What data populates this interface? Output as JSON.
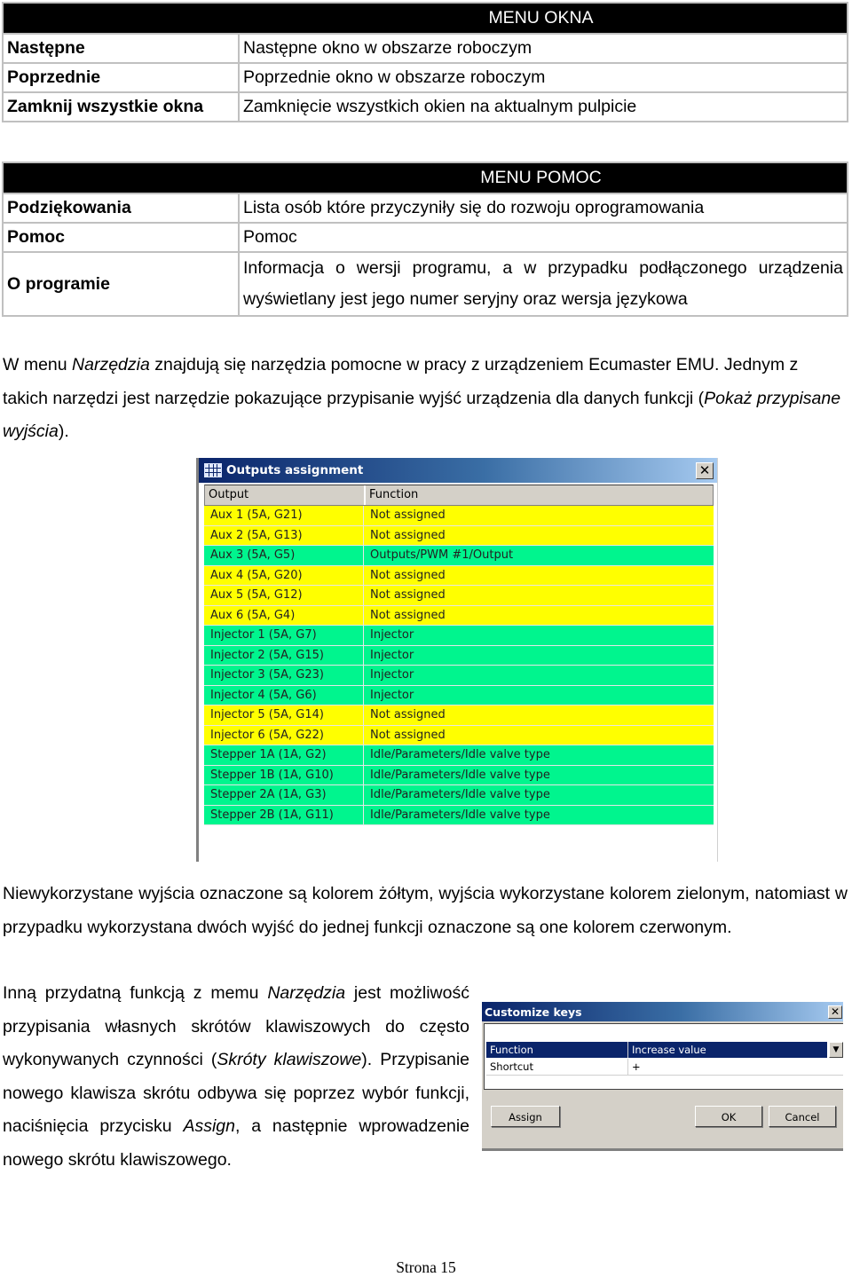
{
  "menu_okna": {
    "title": "MENU OKNA",
    "rows": [
      {
        "key": "Następne",
        "desc": "Następne okno w obszarze roboczym"
      },
      {
        "key": "Poprzednie",
        "desc": "Poprzednie okno w obszarze roboczym"
      },
      {
        "key": "Zamknij wszystkie okna",
        "desc": "Zamknięcie wszystkich okien na aktualnym pulpicie"
      }
    ]
  },
  "menu_pomoc": {
    "title": "MENU POMOC",
    "rows": [
      {
        "key": "Podziękowania",
        "desc": "Lista osób które przyczyniły się do rozwoju oprogramowania"
      },
      {
        "key": "Pomoc",
        "desc": "Pomoc"
      },
      {
        "key": "O programie",
        "desc": "Informacja o wersji programu, a w przypadku podłączonego urządzenia wyświetlany jest jego numer seryjny oraz wersja językowa"
      }
    ]
  },
  "para1": {
    "t1": "W menu ",
    "i1": "Narzędzia",
    "t2": " znajdują się narzędzia pomocne w pracy z urządzeniem Ecumaster EMU. Jednym z takich narzędzi jest narzędzie pokazujące przypisanie wyjść urządzenia dla danych funkcji (",
    "i2": "Pokaż przypisane wyjścia",
    "t3": ")."
  },
  "outputs_window": {
    "title": "Outputs assignment",
    "close": "✕",
    "columns": [
      "Output",
      "Function"
    ],
    "colors": {
      "unused": "#ffff00",
      "used": "#00f58e",
      "double": "#ff0000"
    },
    "rows": [
      {
        "output": "Aux 1 (5A, G21)",
        "function": "Not assigned",
        "status": "unused"
      },
      {
        "output": "Aux 2 (5A, G13)",
        "function": "Not assigned",
        "status": "unused"
      },
      {
        "output": "Aux 3 (5A, G5)",
        "function": "Outputs/PWM #1/Output",
        "status": "used"
      },
      {
        "output": "Aux 4 (5A, G20)",
        "function": "Not assigned",
        "status": "unused"
      },
      {
        "output": "Aux 5 (5A, G12)",
        "function": "Not assigned",
        "status": "unused"
      },
      {
        "output": "Aux 6 (5A, G4)",
        "function": "Not assigned",
        "status": "unused"
      },
      {
        "output": "Injector 1 (5A, G7)",
        "function": "Injector",
        "status": "used"
      },
      {
        "output": "Injector 2 (5A, G15)",
        "function": "Injector",
        "status": "used"
      },
      {
        "output": "Injector 3 (5A, G23)",
        "function": "Injector",
        "status": "used"
      },
      {
        "output": "Injector 4 (5A, G6)",
        "function": "Injector",
        "status": "used"
      },
      {
        "output": "Injector 5 (5A, G14)",
        "function": "Not assigned",
        "status": "unused"
      },
      {
        "output": "Injector 6 (5A, G22)",
        "function": "Not assigned",
        "status": "unused"
      },
      {
        "output": "Stepper 1A (1A, G2)",
        "function": "Idle/Parameters/Idle valve type",
        "status": "used"
      },
      {
        "output": "Stepper 1B (1A, G10)",
        "function": "Idle/Parameters/Idle valve type",
        "status": "used"
      },
      {
        "output": "Stepper 2A (1A, G3)",
        "function": "Idle/Parameters/Idle valve type",
        "status": "used"
      },
      {
        "output": "Stepper 2B (1A, G11)",
        "function": "Idle/Parameters/Idle valve type",
        "status": "used"
      }
    ]
  },
  "para2": {
    "text": "Niewykorzystane wyjścia oznaczone są kolorem żółtym, wyjścia wykorzystane kolorem zielonym, natomiast w przypadku wykorzystana dwóch wyjść do jednej funkcji oznaczone są one kolorem czerwonym."
  },
  "para3": {
    "t1": "Inną przydatną funkcją z memu ",
    "i1": "Narzędzia",
    "t2": " jest możliwość przypisania własnych skrótów klawiszowych do często wykonywanych czynności (",
    "i2": "Skróty klawiszowe",
    "t3": ").  Przypisanie nowego klawisza skrótu odbywa się poprzez wybór funkcji, naciśnięcia przycisku ",
    "i3": "Assign",
    "t4": ", a następnie wprowadzenie nowego skrótu klawiszowego."
  },
  "keys_dialog": {
    "title": "Customize keys",
    "close": "✕",
    "function_label": "Function",
    "function_value": "Increase value",
    "dropdown_arrow": "▼",
    "shortcut_label": "Shortcut",
    "shortcut_value": "+",
    "assign_label": "Assign",
    "ok_label": "OK",
    "cancel_label": "Cancel"
  },
  "footer": {
    "page": "Strona 15"
  }
}
